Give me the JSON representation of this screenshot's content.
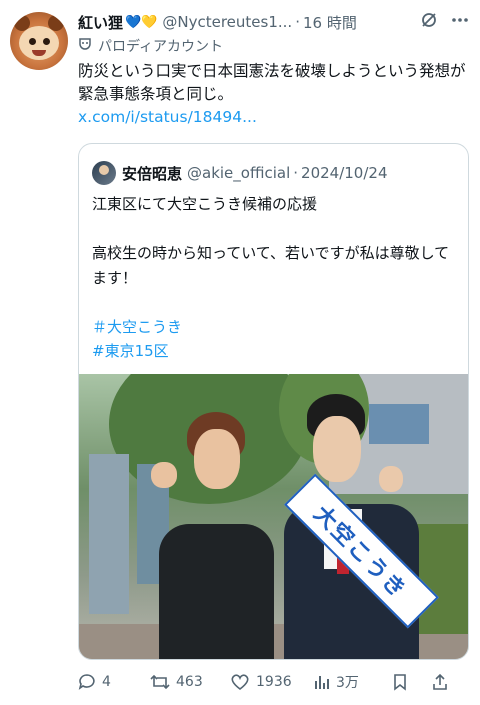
{
  "post": {
    "display_name": "紅い狸",
    "badges": "💙💛",
    "handle": "@Nyctereutes1...",
    "separator": "·",
    "time": "16 時間",
    "account_label": "パロディアカウント",
    "text": "防災という口実で日本国憲法を破壊しようという発想が緊急事態条項と同じ。",
    "link": "x.com/i/status/18494..."
  },
  "quote": {
    "display_name": "安倍昭恵",
    "handle": "@akie_official",
    "separator": "·",
    "date": "2024/10/24",
    "line1": "江東区にて大空こうき候補の応援",
    "line2": "高校生の時から知っていて、若いですが私は尊敬してます！",
    "hashtag1": "＃大空こうき",
    "hashtag2": "#東京15区",
    "photo_sash_text": "大空こうき"
  },
  "actions": {
    "replies": "4",
    "reposts": "463",
    "likes": "1936",
    "views": "3万"
  },
  "icons": {
    "grok": "grok-icon",
    "more": "more-icon",
    "parody": "parody-mask-icon",
    "reply": "reply-icon",
    "repost": "repost-icon",
    "like": "heart-icon",
    "views": "views-icon",
    "bookmark": "bookmark-icon",
    "share": "share-icon"
  },
  "colors": {
    "link": "#1d9bf0",
    "secondary_text": "#536471",
    "border": "#cfd9de"
  }
}
